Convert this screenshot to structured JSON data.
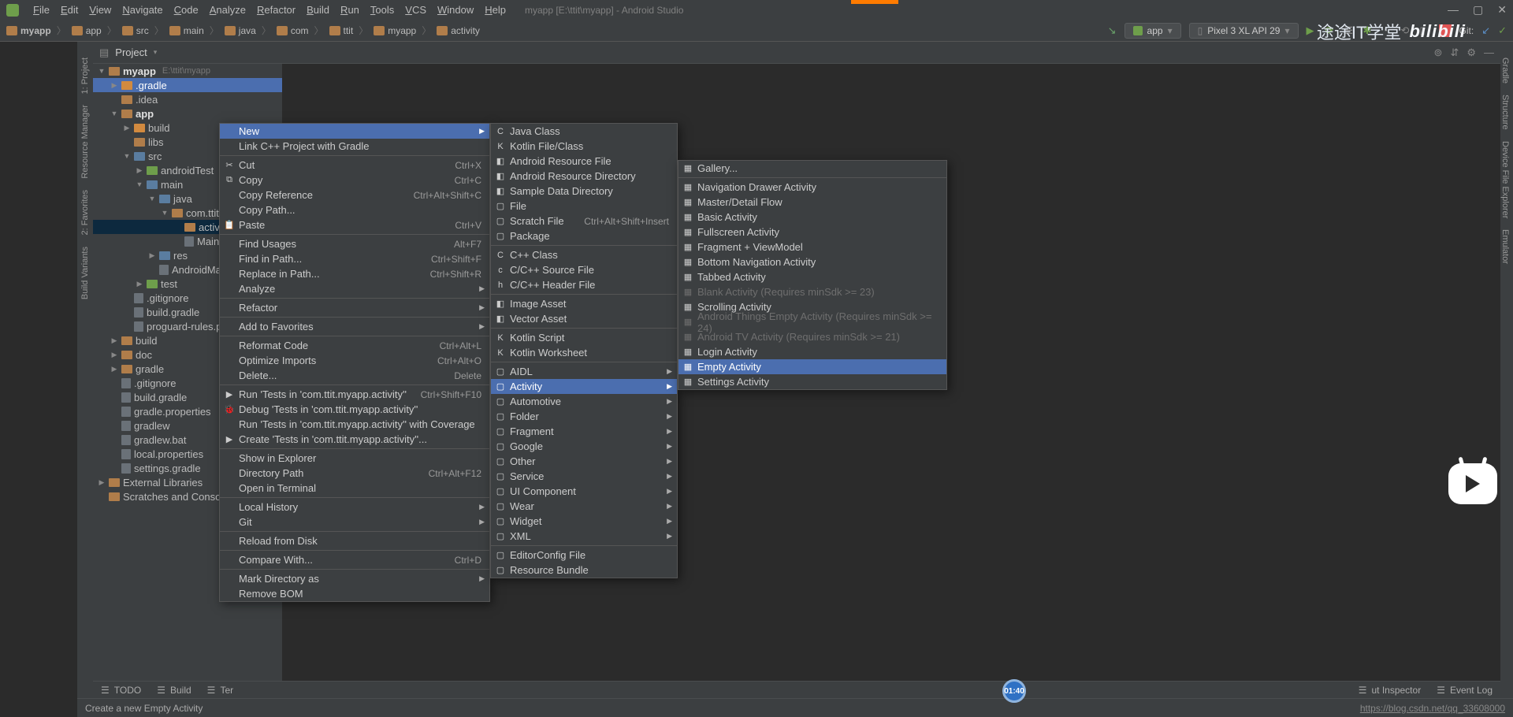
{
  "window": {
    "title": "myapp [E:\\ttit\\myapp] - Android Studio"
  },
  "menubar": [
    "File",
    "Edit",
    "View",
    "Navigate",
    "Code",
    "Analyze",
    "Refactor",
    "Build",
    "Run",
    "Tools",
    "VCS",
    "Window",
    "Help"
  ],
  "breadcrumbs": [
    "myapp",
    "app",
    "src",
    "main",
    "java",
    "com",
    "ttit",
    "myapp",
    "activity"
  ],
  "run_config": {
    "module": "app",
    "device": "Pixel 3 XL API 29",
    "vcs": "Git:"
  },
  "overlay": {
    "brand": "途途IT学堂",
    "site": "bilibili"
  },
  "project_header": {
    "label": "Project"
  },
  "tree": [
    {
      "d": 0,
      "exp": "▼",
      "icon": "fld",
      "label": "myapp",
      "path": "E:\\ttit\\myapp",
      "bold": true
    },
    {
      "d": 1,
      "exp": "▶",
      "icon": "fld orange",
      "label": ".gradle",
      "hl": true
    },
    {
      "d": 1,
      "exp": "",
      "icon": "fld",
      "label": ".idea"
    },
    {
      "d": 1,
      "exp": "▼",
      "icon": "fld",
      "label": "app",
      "bold": true
    },
    {
      "d": 2,
      "exp": "▶",
      "icon": "fld orange",
      "label": "build"
    },
    {
      "d": 2,
      "exp": "",
      "icon": "fld",
      "label": "libs"
    },
    {
      "d": 2,
      "exp": "▼",
      "icon": "fld blue",
      "label": "src"
    },
    {
      "d": 3,
      "exp": "▶",
      "icon": "fld green",
      "label": "androidTest"
    },
    {
      "d": 3,
      "exp": "▼",
      "icon": "fld blue",
      "label": "main"
    },
    {
      "d": 4,
      "exp": "▼",
      "icon": "fld blue",
      "label": "java"
    },
    {
      "d": 5,
      "exp": "▼",
      "icon": "fld",
      "label": "com.ttit"
    },
    {
      "d": 6,
      "exp": "",
      "icon": "fld",
      "label": "activi",
      "sel": true
    },
    {
      "d": 6,
      "exp": "",
      "icon": "file",
      "label": "Main"
    },
    {
      "d": 4,
      "exp": "▶",
      "icon": "fld blue",
      "label": "res"
    },
    {
      "d": 4,
      "exp": "",
      "icon": "file",
      "label": "AndroidMa"
    },
    {
      "d": 3,
      "exp": "▶",
      "icon": "fld green",
      "label": "test"
    },
    {
      "d": 2,
      "exp": "",
      "icon": "file",
      "label": ".gitignore"
    },
    {
      "d": 2,
      "exp": "",
      "icon": "file",
      "label": "build.gradle"
    },
    {
      "d": 2,
      "exp": "",
      "icon": "file",
      "label": "proguard-rules.p"
    },
    {
      "d": 1,
      "exp": "▶",
      "icon": "fld",
      "label": "build"
    },
    {
      "d": 1,
      "exp": "▶",
      "icon": "fld",
      "label": "doc"
    },
    {
      "d": 1,
      "exp": "▶",
      "icon": "fld",
      "label": "gradle"
    },
    {
      "d": 1,
      "exp": "",
      "icon": "file",
      "label": ".gitignore"
    },
    {
      "d": 1,
      "exp": "",
      "icon": "file",
      "label": "build.gradle"
    },
    {
      "d": 1,
      "exp": "",
      "icon": "file",
      "label": "gradle.properties"
    },
    {
      "d": 1,
      "exp": "",
      "icon": "file",
      "label": "gradlew"
    },
    {
      "d": 1,
      "exp": "",
      "icon": "file",
      "label": "gradlew.bat"
    },
    {
      "d": 1,
      "exp": "",
      "icon": "file",
      "label": "local.properties"
    },
    {
      "d": 1,
      "exp": "",
      "icon": "file",
      "label": "settings.gradle"
    },
    {
      "d": 0,
      "exp": "▶",
      "icon": "fld",
      "label": "External Libraries"
    },
    {
      "d": 0,
      "exp": "",
      "icon": "fld",
      "label": "Scratches and Console"
    }
  ],
  "ctx1": [
    {
      "t": "New",
      "arrow": true,
      "hov": true
    },
    {
      "t": "Link C++ Project with Gradle"
    },
    {
      "sep": true
    },
    {
      "t": "Cut",
      "sc": "Ctrl+X",
      "ic": "✂"
    },
    {
      "t": "Copy",
      "sc": "Ctrl+C",
      "ic": "⧉"
    },
    {
      "t": "Copy Reference",
      "sc": "Ctrl+Alt+Shift+C"
    },
    {
      "t": "Copy Path..."
    },
    {
      "t": "Paste",
      "sc": "Ctrl+V",
      "ic": "📋"
    },
    {
      "sep": true
    },
    {
      "t": "Find Usages",
      "sc": "Alt+F7"
    },
    {
      "t": "Find in Path...",
      "sc": "Ctrl+Shift+F"
    },
    {
      "t": "Replace in Path...",
      "sc": "Ctrl+Shift+R"
    },
    {
      "t": "Analyze",
      "arrow": true
    },
    {
      "sep": true
    },
    {
      "t": "Refactor",
      "arrow": true
    },
    {
      "sep": true
    },
    {
      "t": "Add to Favorites",
      "arrow": true
    },
    {
      "sep": true
    },
    {
      "t": "Reformat Code",
      "sc": "Ctrl+Alt+L"
    },
    {
      "t": "Optimize Imports",
      "sc": "Ctrl+Alt+O"
    },
    {
      "t": "Delete...",
      "sc": "Delete"
    },
    {
      "sep": true
    },
    {
      "t": "Run 'Tests in 'com.ttit.myapp.activity''",
      "sc": "Ctrl+Shift+F10",
      "ic": "▶"
    },
    {
      "t": "Debug 'Tests in 'com.ttit.myapp.activity''",
      "ic": "🐞"
    },
    {
      "t": "Run 'Tests in 'com.ttit.myapp.activity'' with Coverage"
    },
    {
      "t": "Create 'Tests in 'com.ttit.myapp.activity''...",
      "ic": "▶"
    },
    {
      "sep": true
    },
    {
      "t": "Show in Explorer"
    },
    {
      "t": "Directory Path",
      "sc": "Ctrl+Alt+F12"
    },
    {
      "t": "Open in Terminal"
    },
    {
      "sep": true
    },
    {
      "t": "Local History",
      "arrow": true
    },
    {
      "t": "Git",
      "arrow": true
    },
    {
      "sep": true
    },
    {
      "t": "Reload from Disk"
    },
    {
      "sep": true
    },
    {
      "t": "Compare With...",
      "sc": "Ctrl+D"
    },
    {
      "sep": true
    },
    {
      "t": "Mark Directory as",
      "arrow": true
    },
    {
      "t": "Remove BOM"
    }
  ],
  "ctx2": [
    {
      "t": "Java Class",
      "ic": "C"
    },
    {
      "t": "Kotlin File/Class",
      "ic": "K"
    },
    {
      "t": "Android Resource File",
      "ic": "◧"
    },
    {
      "t": "Android Resource Directory",
      "ic": "◧"
    },
    {
      "t": "Sample Data Directory",
      "ic": "◧"
    },
    {
      "t": "File",
      "ic": "▢"
    },
    {
      "t": "Scratch File",
      "sc": "Ctrl+Alt+Shift+Insert",
      "ic": "▢"
    },
    {
      "t": "Package",
      "ic": "▢"
    },
    {
      "sep": true
    },
    {
      "t": "C++ Class",
      "ic": "C"
    },
    {
      "t": "C/C++ Source File",
      "ic": "c"
    },
    {
      "t": "C/C++ Header File",
      "ic": "h"
    },
    {
      "sep": true
    },
    {
      "t": "Image Asset",
      "ic": "◧"
    },
    {
      "t": "Vector Asset",
      "ic": "◧"
    },
    {
      "sep": true
    },
    {
      "t": "Kotlin Script",
      "ic": "K"
    },
    {
      "t": "Kotlin Worksheet",
      "ic": "K"
    },
    {
      "sep": true
    },
    {
      "t": "AIDL",
      "arrow": true,
      "ic": "▢"
    },
    {
      "t": "Activity",
      "arrow": true,
      "ic": "▢",
      "hov": true
    },
    {
      "t": "Automotive",
      "arrow": true,
      "ic": "▢"
    },
    {
      "t": "Folder",
      "arrow": true,
      "ic": "▢"
    },
    {
      "t": "Fragment",
      "arrow": true,
      "ic": "▢"
    },
    {
      "t": "Google",
      "arrow": true,
      "ic": "▢"
    },
    {
      "t": "Other",
      "arrow": true,
      "ic": "▢"
    },
    {
      "t": "Service",
      "arrow": true,
      "ic": "▢"
    },
    {
      "t": "UI Component",
      "arrow": true,
      "ic": "▢"
    },
    {
      "t": "Wear",
      "arrow": true,
      "ic": "▢"
    },
    {
      "t": "Widget",
      "arrow": true,
      "ic": "▢"
    },
    {
      "t": "XML",
      "arrow": true,
      "ic": "▢"
    },
    {
      "sep": true
    },
    {
      "t": "EditorConfig File",
      "ic": "▢"
    },
    {
      "t": "Resource Bundle",
      "ic": "▢"
    }
  ],
  "ctx3": [
    {
      "t": "Gallery...",
      "ic": "▦"
    },
    {
      "sep": true
    },
    {
      "t": "Navigation Drawer Activity",
      "ic": "▦"
    },
    {
      "t": "Master/Detail Flow",
      "ic": "▦"
    },
    {
      "t": "Basic Activity",
      "ic": "▦"
    },
    {
      "t": "Fullscreen Activity",
      "ic": "▦"
    },
    {
      "t": "Fragment + ViewModel",
      "ic": "▦"
    },
    {
      "t": "Bottom Navigation Activity",
      "ic": "▦"
    },
    {
      "t": "Tabbed Activity",
      "ic": "▦"
    },
    {
      "t": "Blank Activity (Requires minSdk >= 23)",
      "disabled": true,
      "ic": "▦"
    },
    {
      "t": "Scrolling Activity",
      "ic": "▦"
    },
    {
      "t": "Android Things Empty Activity (Requires minSdk >= 24)",
      "disabled": true,
      "ic": "▦"
    },
    {
      "t": "Android TV Activity (Requires minSdk >= 21)",
      "disabled": true,
      "ic": "▦"
    },
    {
      "t": "Login Activity",
      "ic": "▦"
    },
    {
      "t": "Empty Activity",
      "ic": "▦",
      "hov": true
    },
    {
      "t": "Settings Activity",
      "ic": "▦"
    }
  ],
  "side_left": [
    "1: Project",
    "Resource Manager"
  ],
  "side_left2": [
    "2: Favorites",
    "Build Variants"
  ],
  "side_right": [
    "Gradle",
    "Structure",
    "Device File Explorer",
    "Emulator"
  ],
  "bottom_tools": [
    "TODO",
    "Build",
    "Ter"
  ],
  "bottom_right": [
    "ut Inspector",
    "Event Log"
  ],
  "status": {
    "msg": "Create a new Empty Activity",
    "time": "01:40",
    "link": "https://blog.csdn.net/qq_33608000"
  }
}
